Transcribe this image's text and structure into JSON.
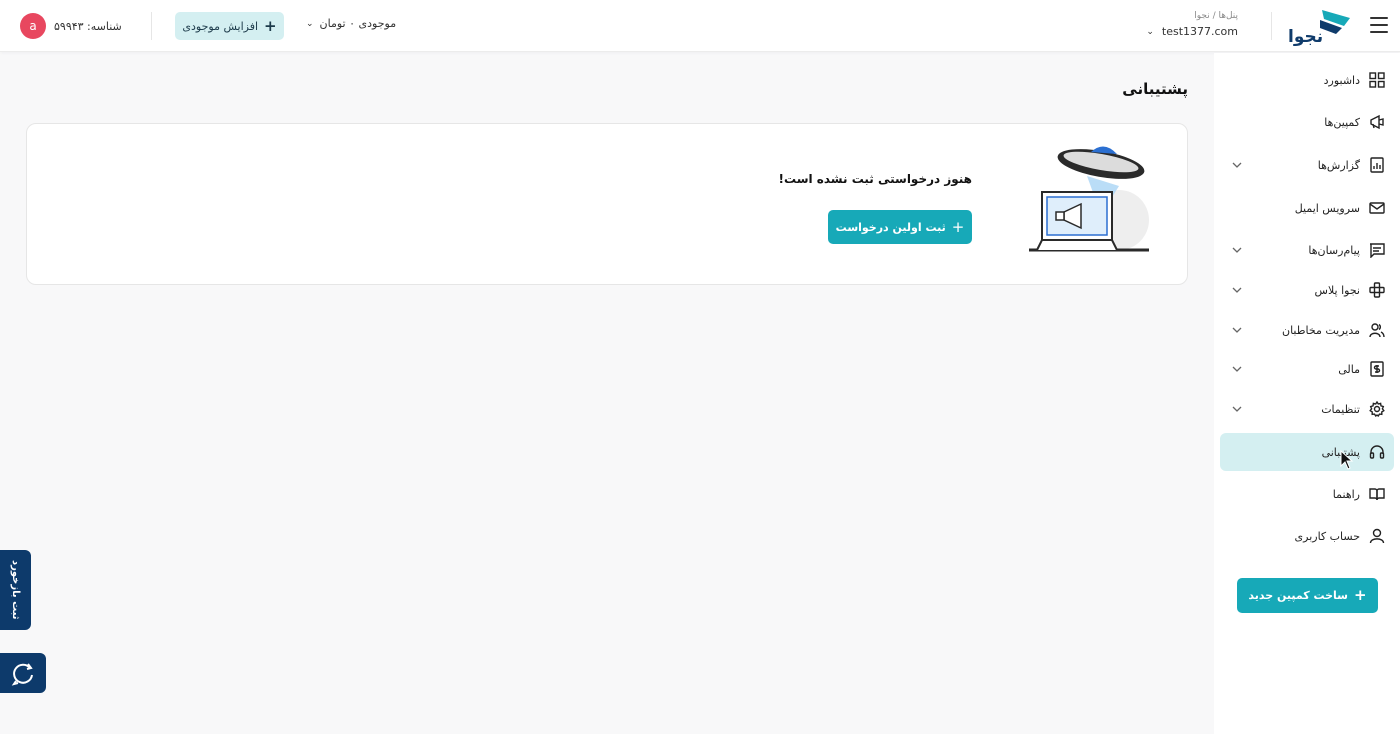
{
  "header": {
    "breadcrumb": "پنل‌ها / نجوا",
    "account_name": "test1377.com",
    "balance_label": "موجودی ۰ تومان",
    "topup_label": "افزایش موجودی",
    "id_label": "شناسه: ۵۹۹۴۳",
    "avatar_letter": "a",
    "logo_text": "نجوا"
  },
  "sidebar": {
    "items": [
      {
        "label": "داشبورد",
        "icon": "dashboard-icon",
        "has_chevron": false
      },
      {
        "label": "کمپین‌ها",
        "icon": "megaphone-icon",
        "has_chevron": false
      },
      {
        "label": "گزارش‌ها",
        "icon": "report-icon",
        "has_chevron": true
      },
      {
        "label": "سرویس ایمیل",
        "icon": "mail-icon",
        "has_chevron": false
      },
      {
        "label": "پیام‌رسان‌ها",
        "icon": "message-icon",
        "has_chevron": true
      },
      {
        "label": "نجوا پلاس",
        "icon": "plus-service-icon",
        "has_chevron": true
      },
      {
        "label": "مدیریت مخاطبان",
        "icon": "users-icon",
        "has_chevron": true
      },
      {
        "label": "مالی",
        "icon": "finance-icon",
        "has_chevron": true
      },
      {
        "label": "تنظیمات",
        "icon": "gear-icon",
        "has_chevron": true
      },
      {
        "label": "پشتیبانی",
        "icon": "headset-icon",
        "has_chevron": false,
        "active": true
      },
      {
        "label": "راهنما",
        "icon": "book-icon",
        "has_chevron": false
      },
      {
        "label": "حساب کاربری",
        "icon": "user-icon",
        "has_chevron": false
      }
    ],
    "new_campaign_label": "ساخت کمپین جدید"
  },
  "main": {
    "page_title": "پشتیبانی",
    "empty_title": "هنوز درخواستی ثبت نشده است!",
    "first_request_label": "ثبت اولین درخواست"
  },
  "widgets": {
    "feedback_label": "ثبت بازخورد"
  },
  "colors": {
    "accent": "#17a9b8",
    "accent_light": "#d4eff1",
    "navy": "#0d3a6b",
    "avatar": "#e8475f"
  }
}
